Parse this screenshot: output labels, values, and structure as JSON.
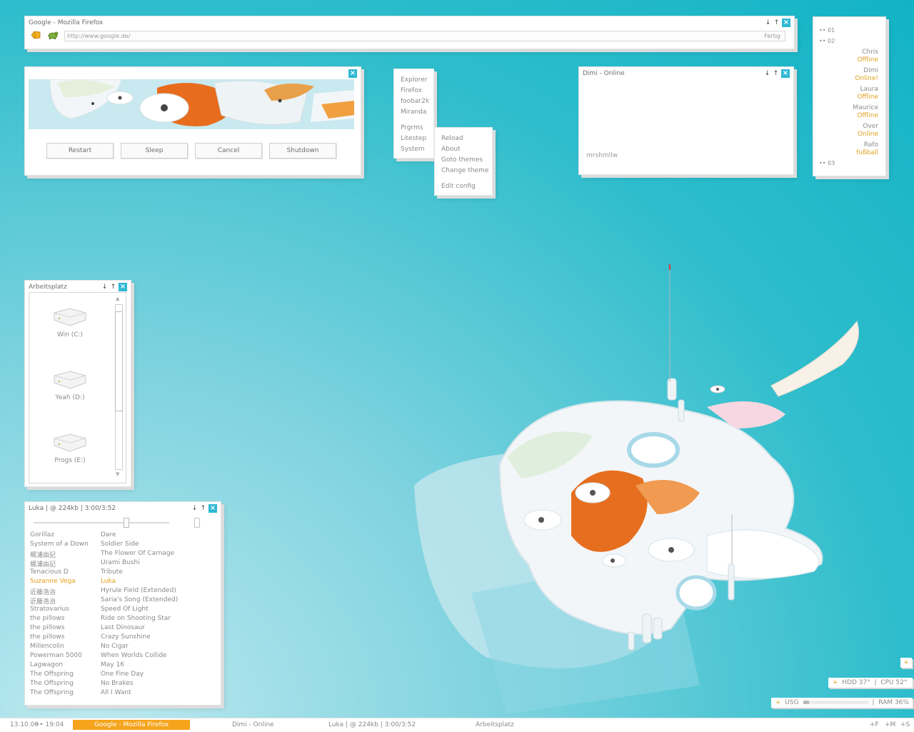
{
  "colors": {
    "accent": "#f5a41c",
    "close": "#2fb8d4"
  },
  "firefox": {
    "title": "Google - Mozilla Firefox",
    "url": "http://www.google.de/",
    "status": "Fertig"
  },
  "shutdown": {
    "buttons": [
      "Restart",
      "Sleep",
      "Cancel",
      "Shutdown"
    ]
  },
  "menu": {
    "items": [
      "Explorer",
      "Firefox",
      "foobar2k",
      "Miranda",
      "Prgrms",
      "Litestep",
      "System"
    ],
    "submenu": [
      "Reload",
      "About",
      "Goto themes",
      "Change theme",
      "Edit config"
    ]
  },
  "chat": {
    "title": "Dimi - Online",
    "message": "mrshmllw"
  },
  "buddies": {
    "group1": "•• 01",
    "group2": "•• 02",
    "group3": "•• 03",
    "list": [
      {
        "name": "Chris",
        "status": "Offline"
      },
      {
        "name": "Dimi",
        "status": "Online!"
      },
      {
        "name": "Laura",
        "status": "Offline"
      },
      {
        "name": "Maurice",
        "status": "Offline"
      },
      {
        "name": "Over",
        "status": "Online"
      },
      {
        "name": "Rafo",
        "status": "fußball"
      }
    ]
  },
  "explorer": {
    "title": "Arbeitsplatz",
    "drives": [
      "Win (C:)",
      "Yeah (D:)",
      "Progs (E:)"
    ]
  },
  "player": {
    "title": "Luka  |  @ 224kb  |   3:00/3:52",
    "progress": 0.68,
    "playlist": [
      {
        "artist": "Gorillaz",
        "track": "Dare"
      },
      {
        "artist": "System of a Down",
        "track": "Soldier Side"
      },
      {
        "artist": "梶浦由記",
        "track": "The Flower Of Carnage"
      },
      {
        "artist": "梶浦由記",
        "track": "Urami Bushi"
      },
      {
        "artist": "Tenacious D",
        "track": "Tribute"
      },
      {
        "artist": "Suzanne Vega",
        "track": "Luka"
      },
      {
        "artist": "近藤浩治",
        "track": "Hyrule Field (Extended)"
      },
      {
        "artist": "近藤浩治",
        "track": "Saria's Song (Extended)"
      },
      {
        "artist": "Stratovarius",
        "track": "Speed Of Light"
      },
      {
        "artist": "the pillows",
        "track": "Ride on Shooting Star"
      },
      {
        "artist": "the pillows",
        "track": "Last Dinosaur"
      },
      {
        "artist": "the pillows",
        "track": "Crazy Sunshine"
      },
      {
        "artist": "Millencolin",
        "track": "No Cigar"
      },
      {
        "artist": "Powerman 5000",
        "track": "When Worlds Collide"
      },
      {
        "artist": "Lagwagon",
        "track": "May 16"
      },
      {
        "artist": "The Offspring",
        "track": "One Fine Day"
      },
      {
        "artist": "The Offspring",
        "track": "No Brakes"
      },
      {
        "artist": "The Offspring",
        "track": "All I Want"
      }
    ]
  },
  "monitors": {
    "hdd": "HDD 37°",
    "cpu": "CPU 52°",
    "usg": "USG",
    "usage": 0.08,
    "ram": "RAM 36%"
  },
  "taskbar": {
    "date": "13.10.06",
    "time": "•• 19:04",
    "tasks": [
      "Google - Mozilla Firefox",
      "Dimi - Online",
      "Luka  |  @ 224kb  |   3:00/3:52",
      "Arbeitsplatz"
    ],
    "tray": [
      "+F",
      "+M",
      "+S"
    ]
  }
}
